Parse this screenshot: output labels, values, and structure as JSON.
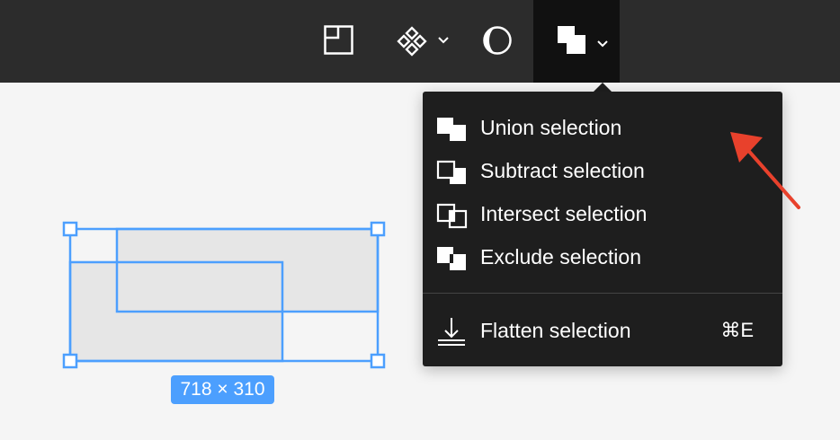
{
  "toolbar": {
    "buttons": [
      {
        "icon": "frame-icon"
      },
      {
        "icon": "component-icon",
        "has_dropdown": true
      },
      {
        "icon": "mask-icon"
      },
      {
        "icon": "boolean-operations-icon",
        "has_dropdown": true,
        "active": true
      }
    ]
  },
  "canvas": {
    "selection_dimensions": "718 × 310",
    "selection_color": "#4c9ffe"
  },
  "boolean_menu": {
    "items": [
      {
        "label": "Union selection",
        "icon": "union-icon"
      },
      {
        "label": "Subtract selection",
        "icon": "subtract-icon"
      },
      {
        "label": "Intersect selection",
        "icon": "intersect-icon"
      },
      {
        "label": "Exclude selection",
        "icon": "exclude-icon"
      }
    ],
    "flatten": {
      "label": "Flatten selection",
      "shortcut": "⌘E",
      "icon": "flatten-icon"
    }
  },
  "annotation": {
    "arrow_color": "#e8412c"
  },
  "colors": {
    "toolbar_bg": "#2c2c2c",
    "menu_bg": "#1e1e1e",
    "canvas_bg": "#f5f5f5",
    "shape_fill": "#e6e6e6"
  }
}
